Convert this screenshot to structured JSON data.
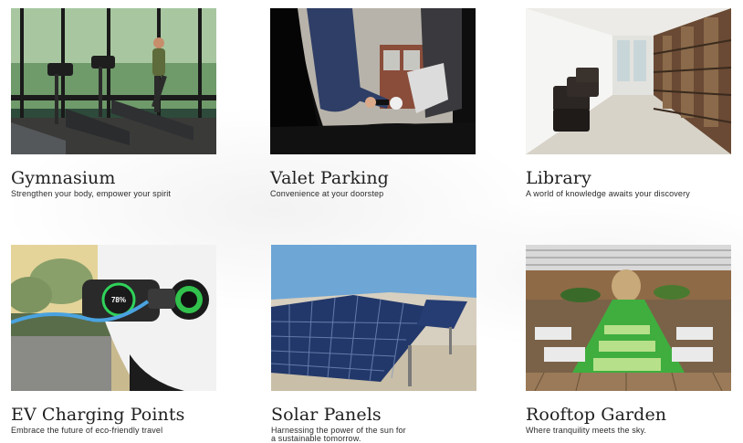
{
  "amenities": [
    {
      "title": "Gymnasium",
      "subtitle": "Strengthen your body, empower your spirit"
    },
    {
      "title": "Valet Parking",
      "subtitle": "Convenience at your doorstep"
    },
    {
      "title": "Library",
      "subtitle": "A world of knowledge awaits your discovery"
    },
    {
      "title": "EV Charging Points",
      "subtitle": "Embrace the future of eco-friendly travel"
    },
    {
      "title": "Solar Panels",
      "subtitle": "Harnessing the power of the sun for a sustainable tomorrow."
    },
    {
      "title": "Rooftop Garden",
      "subtitle": "Where tranquility meets the sky."
    }
  ],
  "ev_display": {
    "percent": "78%"
  }
}
